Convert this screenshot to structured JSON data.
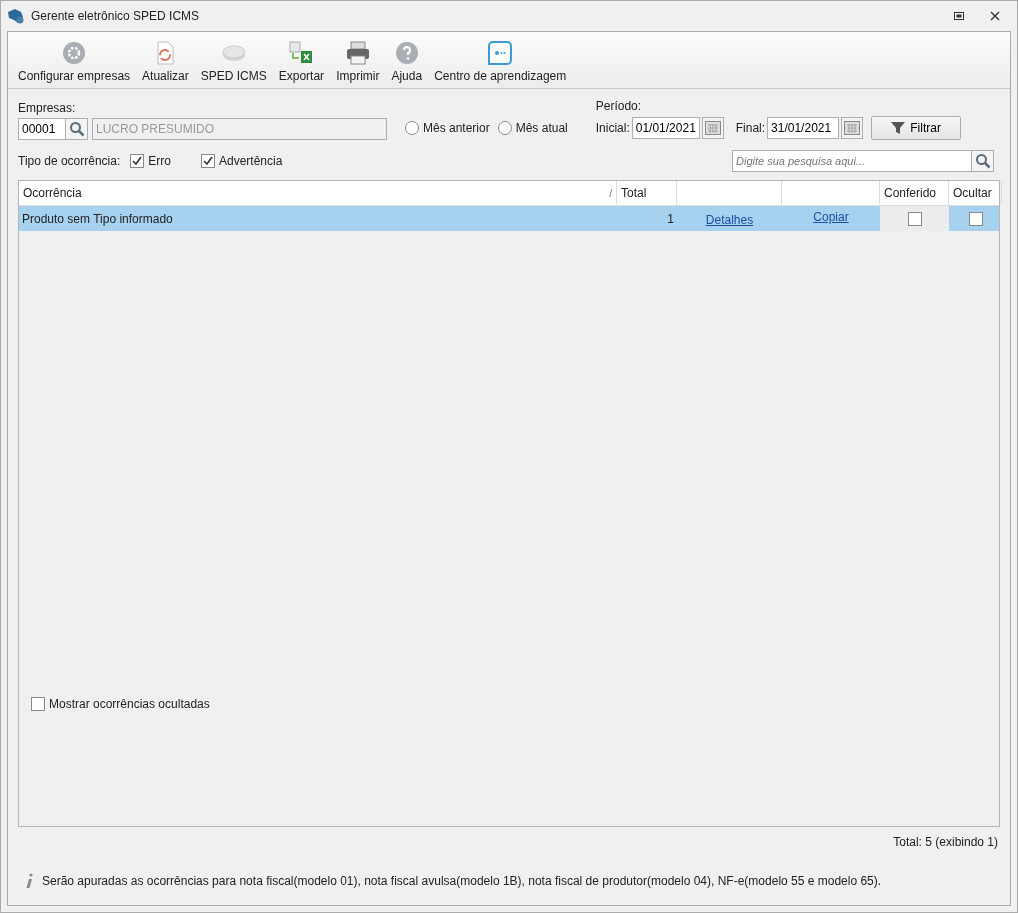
{
  "window": {
    "title": "Gerente eletrônico SPED ICMS"
  },
  "toolbar": [
    {
      "kind": "gear",
      "label": "Configurar empresas"
    },
    {
      "kind": "refresh",
      "label": "Atualizar"
    },
    {
      "kind": "disc",
      "label": "SPED ICMS"
    },
    {
      "kind": "excel",
      "label": "Exportar"
    },
    {
      "kind": "printer",
      "label": "Imprimir"
    },
    {
      "kind": "help",
      "label": "Ajuda"
    },
    {
      "kind": "chat",
      "label": "Centro de aprendizagem"
    }
  ],
  "empresas": {
    "label": "Empresas:",
    "code": "00001",
    "name": "LUCRO PRESUMIDO"
  },
  "month_options": [
    {
      "label": "Mês anterior",
      "selected": false
    },
    {
      "label": "Mês atual",
      "selected": false
    }
  ],
  "periodo": {
    "label": "Período:",
    "start_label": "Inicial:",
    "start": "01/01/2021",
    "end_label": "Final:",
    "end": "31/01/2021"
  },
  "filter_button": "Filtrar",
  "tipo": {
    "label": "Tipo de ocorrência:",
    "options": [
      {
        "label": "Erro",
        "checked": true
      },
      {
        "label": "Advertência",
        "checked": true
      }
    ]
  },
  "search": {
    "placeholder": "Digite sua pesquisa aqui..."
  },
  "table": {
    "columns": [
      "Ocorrência",
      "Total",
      "",
      "",
      "Conferido",
      "Ocultar"
    ],
    "sort_mark": "/",
    "rows": [
      {
        "ocorrencia": "Produto sem Tipo informado",
        "total": "1",
        "details_link": "Detalhes",
        "copy_link": "Copiar",
        "conferido": false,
        "ocultar": false,
        "selected": true
      }
    ]
  },
  "show_hidden": {
    "label": "Mostrar ocorrências ocultadas",
    "checked": false
  },
  "status_total": "Total: 5 (exibindo 1)",
  "info": "Serão apuradas as ocorrências para nota fiscal(modelo 01), nota fiscal avulsa(modelo 1B), nota fiscal de produtor(modelo 04), NF-e(modelo 55 e modelo 65)."
}
